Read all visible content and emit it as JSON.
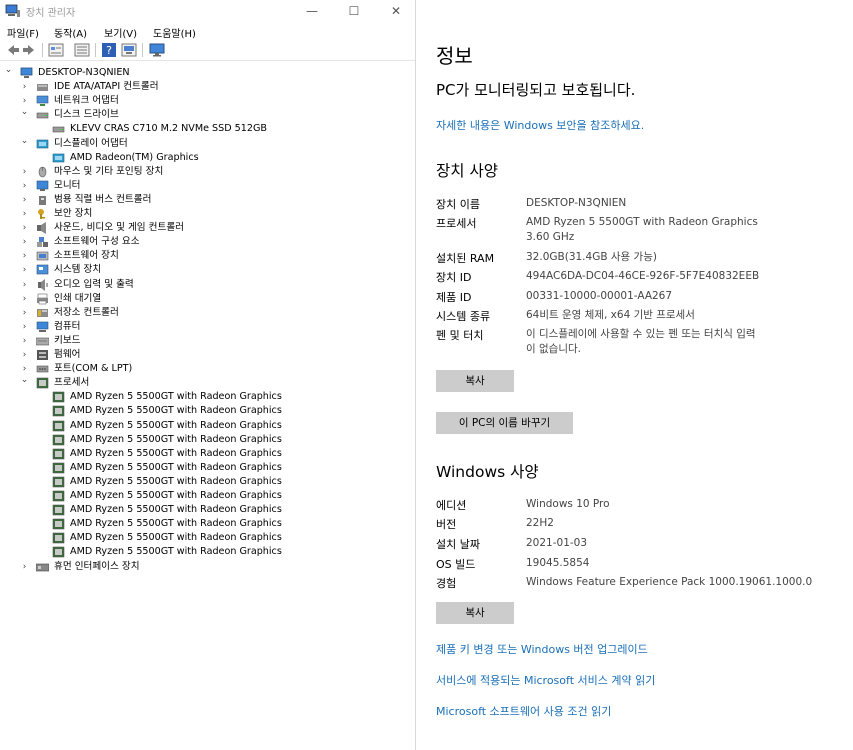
{
  "device_manager": {
    "title": "장치 관리자",
    "window_controls": {
      "minimize": "—",
      "maximize": "☐",
      "close": "✕"
    },
    "menus": [
      "파일(F)",
      "동작(A)",
      "보기(V)",
      "도움말(H)"
    ],
    "toolbar_icons": [
      "back-icon",
      "forward-icon",
      "properties-icon",
      "refresh-list-icon",
      "help-icon",
      "update-driver-icon",
      "monitor-icon"
    ],
    "root": "DESKTOP-N3QNIEN",
    "categories": [
      {
        "label": "IDE ATA/ATAPI 컨트롤러",
        "icon": "ide-controller-icon",
        "expanded": false,
        "children": []
      },
      {
        "label": "네트워크 어댑터",
        "icon": "network-adapter-icon",
        "expanded": false,
        "children": []
      },
      {
        "label": "디스크 드라이브",
        "icon": "disk-drive-icon",
        "expanded": true,
        "children": [
          "KLEVV CRAS C710 M.2 NVMe SSD 512GB"
        ]
      },
      {
        "label": "디스플레이 어댑터",
        "icon": "display-adapter-icon",
        "expanded": true,
        "children": [
          "AMD Radeon(TM) Graphics"
        ]
      },
      {
        "label": "마우스 및 기타 포인팅 장치",
        "icon": "mouse-icon",
        "expanded": false,
        "children": []
      },
      {
        "label": "모니터",
        "icon": "monitor-icon",
        "expanded": false,
        "children": []
      },
      {
        "label": "범용 직렬 버스 컨트롤러",
        "icon": "usb-controller-icon",
        "expanded": false,
        "children": []
      },
      {
        "label": "보안 장치",
        "icon": "security-device-icon",
        "expanded": false,
        "children": []
      },
      {
        "label": "사운드, 비디오 및 게임 컨트롤러",
        "icon": "sound-icon",
        "expanded": false,
        "children": []
      },
      {
        "label": "소프트웨어 구성 요소",
        "icon": "software-component-icon",
        "expanded": false,
        "children": []
      },
      {
        "label": "소프트웨어 장치",
        "icon": "software-device-icon",
        "expanded": false,
        "children": []
      },
      {
        "label": "시스템 장치",
        "icon": "system-device-icon",
        "expanded": false,
        "children": []
      },
      {
        "label": "오디오 입력 및 출력",
        "icon": "audio-io-icon",
        "expanded": false,
        "children": []
      },
      {
        "label": "인쇄 대기열",
        "icon": "print-queue-icon",
        "expanded": false,
        "children": []
      },
      {
        "label": "저장소 컨트롤러",
        "icon": "storage-controller-icon",
        "expanded": false,
        "children": []
      },
      {
        "label": "컴퓨터",
        "icon": "computer-icon",
        "expanded": false,
        "children": []
      },
      {
        "label": "키보드",
        "icon": "keyboard-icon",
        "expanded": false,
        "children": []
      },
      {
        "label": "펌웨어",
        "icon": "firmware-icon",
        "expanded": false,
        "children": []
      },
      {
        "label": "포트(COM & LPT)",
        "icon": "port-icon",
        "expanded": false,
        "children": []
      },
      {
        "label": "프로세서",
        "icon": "processor-icon",
        "expanded": true,
        "children": [
          "AMD Ryzen 5 5500GT with Radeon Graphics",
          "AMD Ryzen 5 5500GT with Radeon Graphics",
          "AMD Ryzen 5 5500GT with Radeon Graphics",
          "AMD Ryzen 5 5500GT with Radeon Graphics",
          "AMD Ryzen 5 5500GT with Radeon Graphics",
          "AMD Ryzen 5 5500GT with Radeon Graphics",
          "AMD Ryzen 5 5500GT with Radeon Graphics",
          "AMD Ryzen 5 5500GT with Radeon Graphics",
          "AMD Ryzen 5 5500GT with Radeon Graphics",
          "AMD Ryzen 5 5500GT with Radeon Graphics",
          "AMD Ryzen 5 5500GT with Radeon Graphics",
          "AMD Ryzen 5 5500GT with Radeon Graphics"
        ]
      },
      {
        "label": "휴먼 인터페이스 장치",
        "icon": "hid-icon",
        "expanded": false,
        "children": []
      }
    ]
  },
  "about": {
    "heading": "정보",
    "protection_status": "PC가 모니터링되고 보호됩니다.",
    "security_link": "자세한 내용은 Windows 보안을 참조하세요.",
    "device_specs_heading": "장치 사양",
    "device_specs": [
      {
        "key": "장치 이름",
        "value": "DESKTOP-N3QNIEN"
      },
      {
        "key": "프로세서",
        "value": "AMD Ryzen 5 5500GT with Radeon Graphics",
        "value2": "3.60 GHz"
      },
      {
        "key": "설치된 RAM",
        "value": "32.0GB(31.4GB 사용 가능)"
      },
      {
        "key": "장치 ID",
        "value": "494AC6DA-DC04-46CE-926F-5F7E40832EEB"
      },
      {
        "key": "제품 ID",
        "value": "00331-10000-00001-AA267"
      },
      {
        "key": "시스템 종류",
        "value": "64비트 운영 체제, x64 기반 프로세서"
      },
      {
        "key": "펜 및 터치",
        "value": "이 디스플레이에 사용할 수 있는 펜 또는 터치식 입력",
        "value2": "이 없습니다."
      }
    ],
    "copy_button": "복사",
    "rename_button": "이 PC의 이름 바꾸기",
    "windows_specs_heading": "Windows 사양",
    "windows_specs": [
      {
        "key": "에디션",
        "value": "Windows 10 Pro"
      },
      {
        "key": "버전",
        "value": "22H2"
      },
      {
        "key": "설치 날짜",
        "value": "2021-01-03"
      },
      {
        "key": "OS 빌드",
        "value": "19045.5854"
      },
      {
        "key": "경험",
        "value": "Windows Feature Experience Pack 1000.19061.1000.0"
      }
    ],
    "copy_button_2": "복사",
    "links": [
      "제품 키 변경 또는 Windows 버전 업그레이드",
      "서비스에 적용되는 Microsoft 서비스 계약 읽기",
      "Microsoft 소프트웨어 사용 조건 읽기"
    ],
    "link_color": "#1a6fb8"
  }
}
